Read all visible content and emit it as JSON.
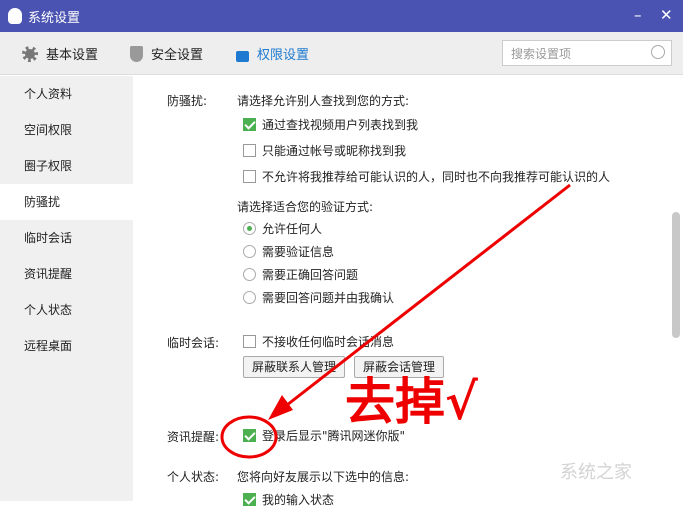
{
  "window": {
    "title": "系统设置",
    "minimize": "–",
    "close": "✕"
  },
  "toolbar": {
    "tabs": [
      {
        "label": "基本设置",
        "icon": "gear-icon"
      },
      {
        "label": "安全设置",
        "icon": "shield-icon"
      },
      {
        "label": "权限设置",
        "icon": "lock-icon",
        "active": true
      }
    ],
    "search_placeholder": "搜索设置项"
  },
  "sidebar": {
    "items": [
      {
        "label": "个人资料"
      },
      {
        "label": "空间权限"
      },
      {
        "label": "圈子权限"
      },
      {
        "label": "防骚扰",
        "active": true
      },
      {
        "label": "临时会话"
      },
      {
        "label": "资讯提醒"
      },
      {
        "label": "个人状态"
      },
      {
        "label": "远程桌面"
      }
    ]
  },
  "antiharass": {
    "label": "防骚扰:",
    "find_prompt": "请选择允许别人查找到您的方式:",
    "find_options": [
      {
        "label": "通过查找视频用户列表找到我",
        "checked": true
      },
      {
        "label": "只能通过帐号或昵称找到我",
        "checked": false
      },
      {
        "label": "不允许将我推荐给可能认识的人，同时也不向我推荐可能认识的人",
        "checked": false
      }
    ],
    "verify_prompt": "请选择适合您的验证方式:",
    "verify_options": [
      {
        "label": "允许任何人",
        "selected": true
      },
      {
        "label": "需要验证信息"
      },
      {
        "label": "需要正确回答问题"
      },
      {
        "label": "需要回答问题并由我确认"
      }
    ]
  },
  "temp_chat": {
    "label": "临时会话:",
    "option": "不接收任何临时会话消息",
    "buttons": [
      "屏蔽联系人管理",
      "屏蔽会话管理"
    ]
  },
  "news": {
    "label": "资讯提醒:",
    "option": "登录后显示\"腾讯网迷你版\"",
    "checked": true
  },
  "status": {
    "label": "个人状态:",
    "prompt": "您将向好友展示以下选中的信息:",
    "option": "我的输入状态"
  },
  "annotation": {
    "text": "去掉√",
    "color": "#e00000"
  },
  "watermark": "系统之家"
}
